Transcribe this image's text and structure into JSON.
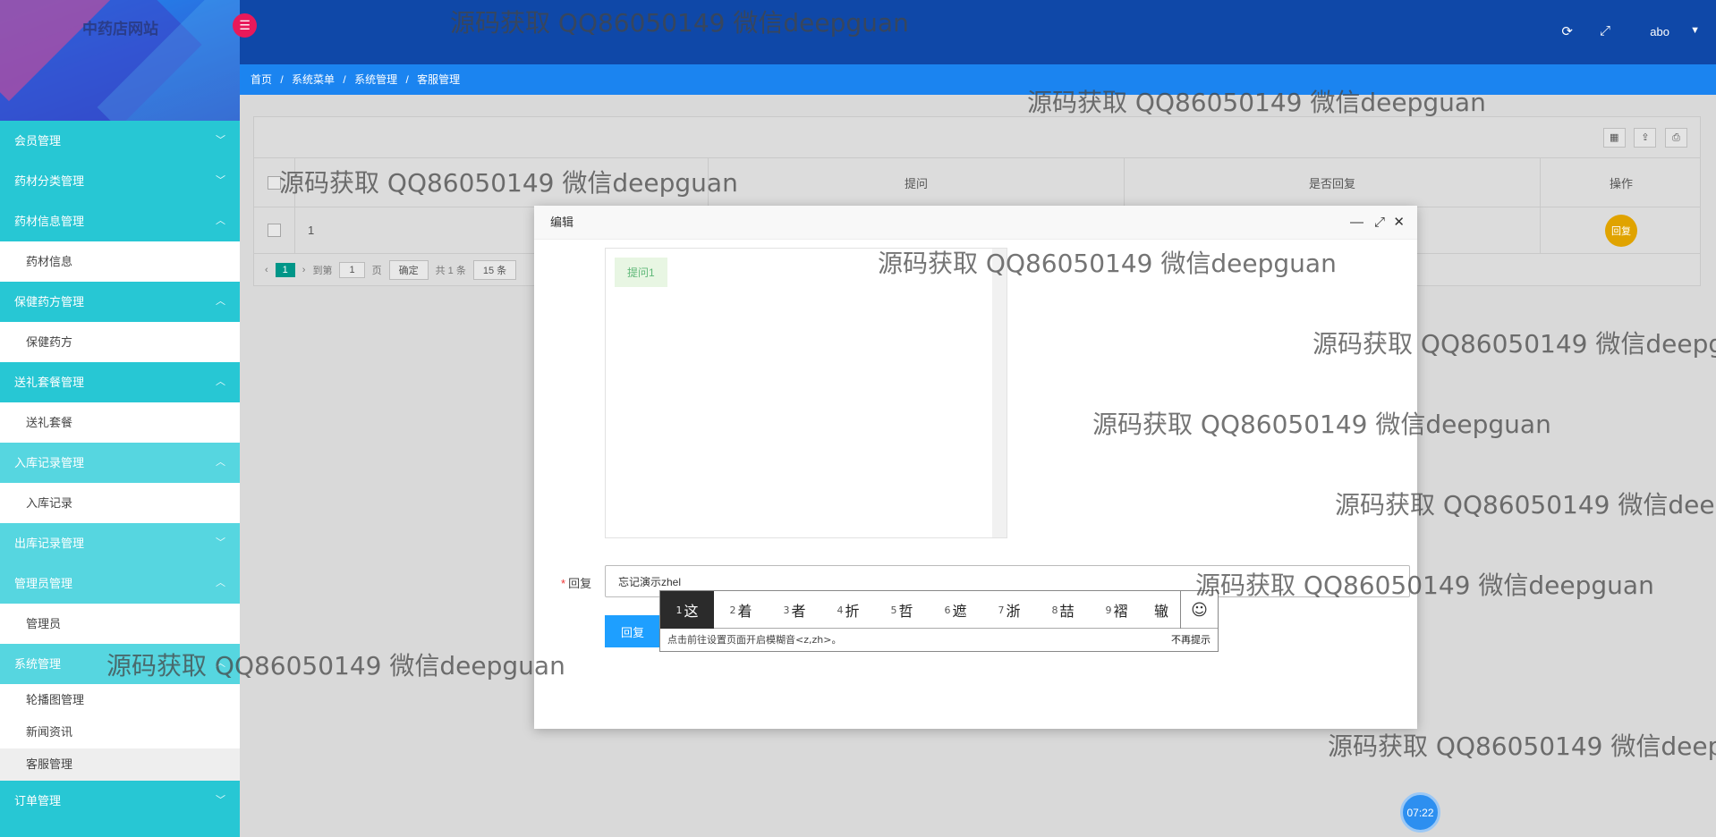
{
  "app": {
    "logo_text": "中药店网站",
    "toggle_icon": "menu-toggle-icon"
  },
  "header": {
    "user": "abo",
    "icons": [
      "refresh-icon",
      "fullscreen-icon"
    ]
  },
  "breadcrumb": [
    "首页",
    "/",
    "系统菜单",
    "/",
    "系统管理",
    "/",
    "客服管理"
  ],
  "sidebar": {
    "items": [
      {
        "label": "会员管理",
        "chev": "⌄"
      },
      {
        "label": "药材分类管理",
        "chev": "⌄"
      },
      {
        "label": "药材信息管理",
        "chev": "⌃",
        "sub": [
          "药材信息"
        ]
      },
      {
        "label": "保健药方管理",
        "chev": "⌃",
        "sub": [
          "保健药方"
        ]
      },
      {
        "label": "送礼套餐管理",
        "chev": "⌃",
        "sub": [
          "送礼套餐"
        ]
      },
      {
        "label": "入库记录管理",
        "chev": "⌃",
        "sub": [
          "入库记录"
        ]
      },
      {
        "label": "出库记录管理",
        "chev": "⌄"
      },
      {
        "label": "管理员管理",
        "chev": "⌃",
        "sub": [
          "管理员"
        ]
      },
      {
        "label": "系统管理",
        "chev": "⌃",
        "sub": [
          "轮播图管理",
          "新闻资讯",
          "客服管理"
        ]
      },
      {
        "label": "订单管理",
        "chev": "⌄"
      }
    ]
  },
  "table": {
    "headers": [
      "提问",
      "是否回复",
      "操作"
    ],
    "row": {
      "index": "1",
      "action": "回复"
    }
  },
  "pager": {
    "current": "1",
    "goto_label": "到第",
    "goto_value": "1",
    "page_unit": "页",
    "confirm": "确定",
    "total": "共 1 条",
    "per_page": "15 条"
  },
  "modal": {
    "title": "编辑",
    "bubble": "提问1",
    "reply_label": "回复",
    "reply_value": "忘记演示zhel",
    "reply_button": "回复"
  },
  "ime": {
    "candidates": [
      {
        "n": "1",
        "c": "这"
      },
      {
        "n": "2",
        "c": "着"
      },
      {
        "n": "3",
        "c": "者"
      },
      {
        "n": "4",
        "c": "折"
      },
      {
        "n": "5",
        "c": "哲"
      },
      {
        "n": "6",
        "c": "遮"
      },
      {
        "n": "7",
        "c": "浙"
      },
      {
        "n": "8",
        "c": "喆"
      },
      {
        "n": "9",
        "c": "褶"
      },
      {
        "n": "",
        "c": "辙"
      }
    ],
    "tip": "点击前往设置页面开启模糊音<z,zh>。",
    "dismiss": "不再提示"
  },
  "clock": "07:22",
  "watermark": "源码获取 QQ86050149 微信deepguan"
}
